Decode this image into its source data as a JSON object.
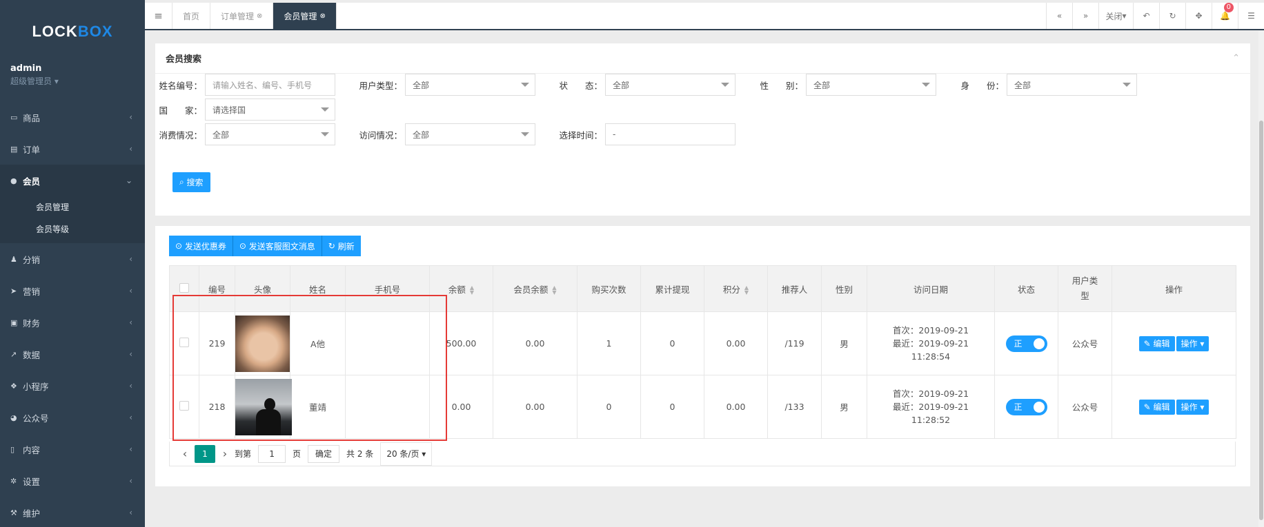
{
  "sidebar": {
    "logo_part1": "LOCK",
    "logo_part2": "BOX",
    "username": "admin",
    "role": "超级管理员 ▾",
    "items": [
      {
        "label": "商品"
      },
      {
        "label": "订单"
      },
      {
        "label": "会员"
      },
      {
        "label": "分销"
      },
      {
        "label": "营销"
      },
      {
        "label": "财务"
      },
      {
        "label": "数据"
      },
      {
        "label": "小程序"
      },
      {
        "label": "公众号"
      },
      {
        "label": "内容"
      },
      {
        "label": "设置"
      },
      {
        "label": "维护"
      }
    ],
    "submenu": [
      "会员管理",
      "会员等级"
    ]
  },
  "topbar": {
    "tabs": [
      {
        "label": "首页"
      },
      {
        "label": "订单管理"
      },
      {
        "label": "会员管理"
      }
    ],
    "close_label": "关闭",
    "notify_count": "0"
  },
  "search": {
    "title": "会员搜索",
    "fields": {
      "name_label": "姓名编号：",
      "name_placeholder": "请输入姓名、编号、手机号",
      "usertype_label": "用户类型：",
      "usertype_value": "全部",
      "status_label": "状　　态：",
      "status_value": "全部",
      "gender_label": "性　　别：",
      "gender_value": "全部",
      "identity_label": "身　　份：",
      "identity_value": "全部",
      "country_label": "国　　家：",
      "country_value": "请选择国",
      "consume_label": "消费情况：",
      "consume_value": "全部",
      "visit_label": "访问情况：",
      "visit_value": "全部",
      "time_label": "选择时间：",
      "time_value": "-"
    },
    "search_button": "搜索"
  },
  "actions": {
    "coupon": "发送优惠券",
    "message": "发送客服图文消息",
    "refresh": "刷新"
  },
  "table": {
    "headers": [
      "编号",
      "头像",
      "姓名",
      "手机号",
      "余额",
      "会员余额",
      "购买次数",
      "累计提现",
      "积分",
      "推荐人",
      "性别",
      "访问日期",
      "状态",
      "用户类型",
      "操作"
    ],
    "rows": [
      {
        "id": "219",
        "name": "A他",
        "phone": "",
        "balance": "500.00",
        "member_balance": "0.00",
        "buys": "1",
        "withdraw": "0",
        "points": "0.00",
        "referrer": "/119",
        "gender": "男",
        "first_visit": "首次：2019-09-21",
        "last_visit": "最近：2019-09-21",
        "last_time": "11:28:54",
        "status": "正",
        "user_type": "公众号",
        "edit": "编辑",
        "more": "操作"
      },
      {
        "id": "218",
        "name": "董靖",
        "phone": "",
        "balance": "0.00",
        "member_balance": "0.00",
        "buys": "0",
        "withdraw": "0",
        "points": "0.00",
        "referrer": "/133",
        "gender": "男",
        "first_visit": "首次：2019-09-21",
        "last_visit": "最近：2019-09-21",
        "last_time": "11:28:52",
        "status": "正",
        "user_type": "公众号",
        "edit": "编辑",
        "more": "操作"
      }
    ]
  },
  "pager": {
    "current": "1",
    "goto_label": "到第",
    "goto_value": "1",
    "page_unit": "页",
    "confirm": "确定",
    "total": "共 2 条",
    "page_size": "20 条/页"
  },
  "colors": {
    "sidebar": "#2f4050",
    "primary": "#1e9fff",
    "pager_active": "#009688",
    "highlight": "#e53935"
  }
}
